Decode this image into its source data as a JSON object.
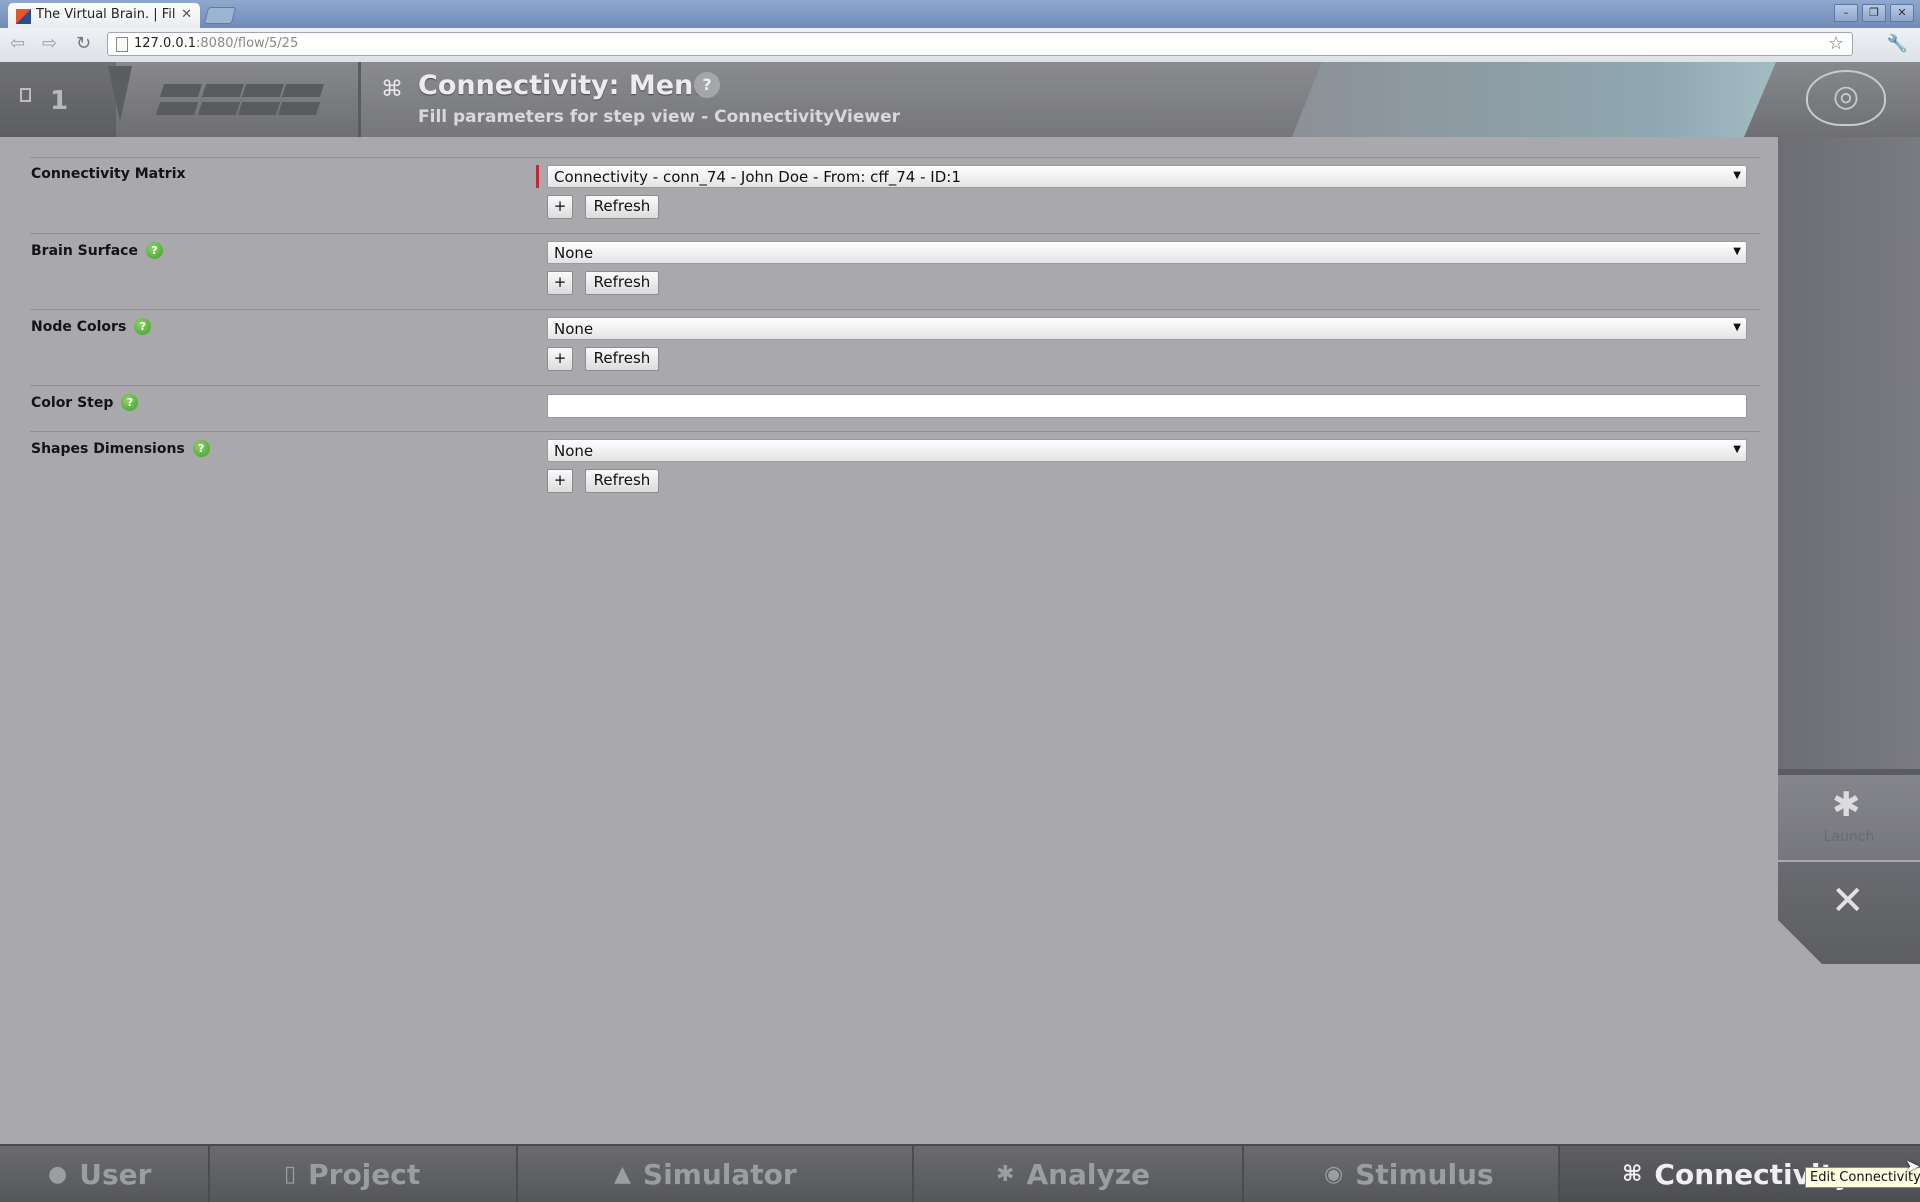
{
  "browser": {
    "tab_title": "The Virtual Brain. | Fill p",
    "tab_close": "✕",
    "url_host": "127.0.0.1",
    "url_rest": ":8080/flow/5/25",
    "window_controls": [
      "–",
      "❐",
      "✕"
    ]
  },
  "header": {
    "project_number": "1",
    "menu_title": "Connectivity: Menu",
    "help_label": "?",
    "subtitle": "Fill parameters for step view - ConnectivityViewer"
  },
  "form": {
    "params": [
      {
        "label": "Connectivity Matrix",
        "type": "select",
        "value": "Connectivity - conn_74 - John Doe - From: cff_74 - ID:1",
        "required": true,
        "has_help": false,
        "add_label": "+",
        "refresh_label": "Refresh"
      },
      {
        "label": "Brain Surface",
        "type": "select",
        "value": "None",
        "has_help": true,
        "add_label": "+",
        "refresh_label": "Refresh"
      },
      {
        "label": "Node Colors",
        "type": "select",
        "value": "None",
        "has_help": true,
        "add_label": "+",
        "refresh_label": "Refresh"
      },
      {
        "label": "Color Step",
        "type": "text",
        "value": "",
        "has_help": true
      },
      {
        "label": "Shapes Dimensions",
        "type": "select",
        "value": "None",
        "has_help": true,
        "add_label": "+",
        "refresh_label": "Refresh"
      }
    ],
    "help_glyph": "?"
  },
  "toolbar": {
    "launch_label": "Launch"
  },
  "bottom_nav": [
    {
      "label": "User",
      "icon": "user-icon"
    },
    {
      "label": "Project",
      "icon": "project-icon"
    },
    {
      "label": "Simulator",
      "icon": "simulator-icon"
    },
    {
      "label": "Analyze",
      "icon": "gear-icon"
    },
    {
      "label": "Stimulus",
      "icon": "pin-icon"
    },
    {
      "label": "Connectivity",
      "icon": "connectivity-icon",
      "active": true
    }
  ],
  "tooltip": "Edit Connectivity"
}
